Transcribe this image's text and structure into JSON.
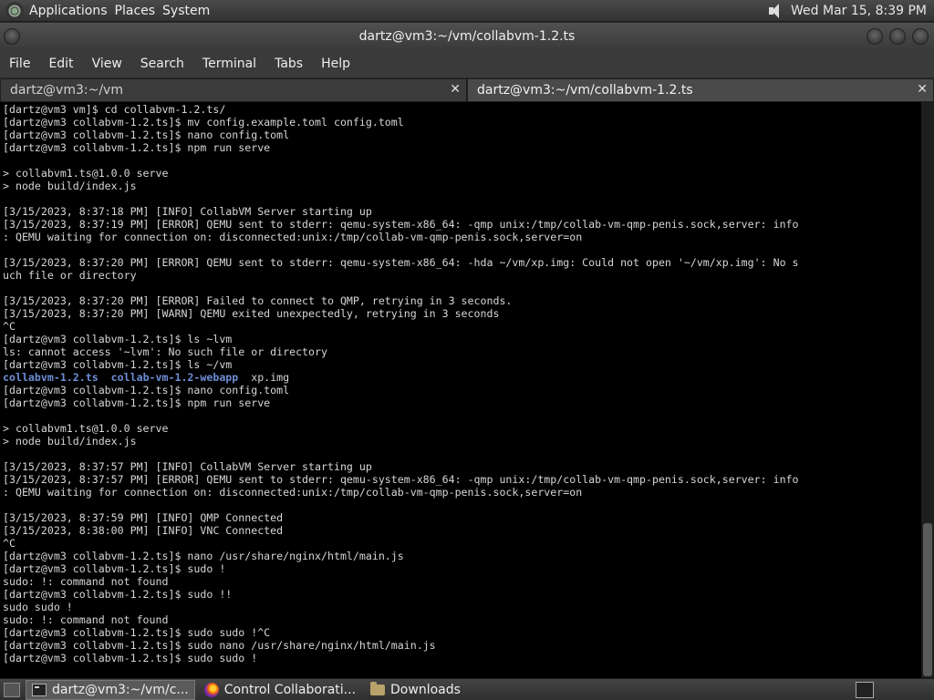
{
  "top_panel": {
    "menus": [
      "Applications",
      "Places",
      "System"
    ],
    "datetime": "Wed Mar 15,  8:39 PM"
  },
  "window": {
    "title": "dartz@vm3:~/vm/collabvm-1.2.ts"
  },
  "menu_bar": [
    "File",
    "Edit",
    "View",
    "Search",
    "Terminal",
    "Tabs",
    "Help"
  ],
  "tabs": [
    {
      "label": "dartz@vm3:~/vm",
      "active": false
    },
    {
      "label": "dartz@vm3:~/vm/collabvm-1.2.ts",
      "active": true
    }
  ],
  "terminal": {
    "lines": [
      "[dartz@vm3 vm]$ cd collabvm-1.2.ts/",
      "[dartz@vm3 collabvm-1.2.ts]$ mv config.example.toml config.toml",
      "[dartz@vm3 collabvm-1.2.ts]$ nano config.toml",
      "[dartz@vm3 collabvm-1.2.ts]$ npm run serve",
      "",
      "> collabvm1.ts@1.0.0 serve",
      "> node build/index.js",
      "",
      "[3/15/2023, 8:37:18 PM] [INFO] CollabVM Server starting up",
      "[3/15/2023, 8:37:19 PM] [ERROR] QEMU sent to stderr: qemu-system-x86_64: -qmp unix:/tmp/collab-vm-qmp-penis.sock,server: info",
      ": QEMU waiting for connection on: disconnected:unix:/tmp/collab-vm-qmp-penis.sock,server=on",
      "",
      "[3/15/2023, 8:37:20 PM] [ERROR] QEMU sent to stderr: qemu-system-x86_64: -hda ~/vm/xp.img: Could not open '~/vm/xp.img': No s",
      "uch file or directory",
      "",
      "[3/15/2023, 8:37:20 PM] [ERROR] Failed to connect to QMP, retrying in 3 seconds.",
      "[3/15/2023, 8:37:20 PM] [WARN] QEMU exited unexpectedly, retrying in 3 seconds",
      "^C",
      "[dartz@vm3 collabvm-1.2.ts]$ ls ~lvm",
      "ls: cannot access '~lvm': No such file or directory",
      "[dartz@vm3 collabvm-1.2.ts]$ ls ~/vm"
    ],
    "ls_output": {
      "dir1": "collabvm-1.2.ts",
      "dir2": "collab-vm-1.2-webapp",
      "file": "xp.img"
    },
    "lines2": [
      "[dartz@vm3 collabvm-1.2.ts]$ nano config.toml",
      "[dartz@vm3 collabvm-1.2.ts]$ npm run serve",
      "",
      "> collabvm1.ts@1.0.0 serve",
      "> node build/index.js",
      "",
      "[3/15/2023, 8:37:57 PM] [INFO] CollabVM Server starting up",
      "[3/15/2023, 8:37:57 PM] [ERROR] QEMU sent to stderr: qemu-system-x86_64: -qmp unix:/tmp/collab-vm-qmp-penis.sock,server: info",
      ": QEMU waiting for connection on: disconnected:unix:/tmp/collab-vm-qmp-penis.sock,server=on",
      "",
      "[3/15/2023, 8:37:59 PM] [INFO] QMP Connected",
      "[3/15/2023, 8:38:00 PM] [INFO] VNC Connected",
      "^C",
      "[dartz@vm3 collabvm-1.2.ts]$ nano /usr/share/nginx/html/main.js",
      "[dartz@vm3 collabvm-1.2.ts]$ sudo !",
      "sudo: !: command not found",
      "[dartz@vm3 collabvm-1.2.ts]$ sudo !!",
      "sudo sudo !",
      "sudo: !: command not found",
      "[dartz@vm3 collabvm-1.2.ts]$ sudo sudo !^C",
      "[dartz@vm3 collabvm-1.2.ts]$ sudo nano /usr/share/nginx/html/main.js",
      "[dartz@vm3 collabvm-1.2.ts]$ sudo sudo !"
    ]
  },
  "taskbar": [
    {
      "label": "dartz@vm3:~/vm/c...",
      "icon": "terminal-icon",
      "active": true
    },
    {
      "label": "Control Collaborati...",
      "icon": "firefox-icon",
      "active": false
    },
    {
      "label": "Downloads",
      "icon": "folder-icon",
      "active": false
    }
  ]
}
